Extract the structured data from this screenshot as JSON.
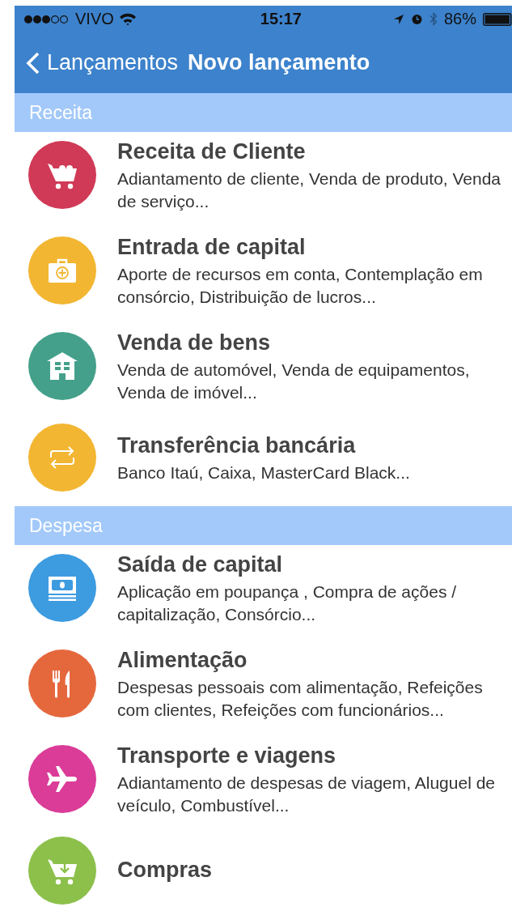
{
  "status_bar": {
    "carrier": "VIVO",
    "time": "15:17",
    "battery": "86%"
  },
  "nav_bar": {
    "back_label": "Lançamentos",
    "title": "Novo lançamento"
  },
  "sections": [
    {
      "header": "Receita",
      "items": [
        {
          "kind": "cart",
          "color": "#d03a56",
          "title": "Receita de Cliente",
          "description": "Adiantamento de cliente, Venda de produto, Venda de serviço..."
        },
        {
          "kind": "kit",
          "color": "#f2b632",
          "title": "Entrada de capital",
          "description": "Aporte de recursos em conta, Contemplação em consórcio, Distribuição de lucros..."
        },
        {
          "kind": "building",
          "color": "#44a08a",
          "title": "Venda de bens",
          "description": "Venda de automóvel, Venda de equipamentos, Venda de imóvel..."
        },
        {
          "kind": "transfer",
          "color": "#f2b632",
          "title": "Transferência bancária",
          "description": "Banco Itaú, Caixa, MasterCard Black..."
        }
      ]
    },
    {
      "header": "Despesa",
      "items": [
        {
          "kind": "money",
          "color": "#3d9be0",
          "title": "Saída de capital",
          "description": "Aplicação em poupança , Compra de ações / capitalização, Consórcio..."
        },
        {
          "kind": "cutlery",
          "color": "#e5683d",
          "title": "Alimentação",
          "description": "Despesas pessoais com alimentação, Refeições com clientes, Refeições com funcionários..."
        },
        {
          "kind": "plane",
          "color": "#da3c98",
          "title": "Transporte e viagens",
          "description": "Adiantamento de despesas de viagem, Aluguel de veículo, Combustível..."
        },
        {
          "kind": "cart-in",
          "color": "#8cc04b",
          "title": "Compras"
        }
      ]
    }
  ]
}
